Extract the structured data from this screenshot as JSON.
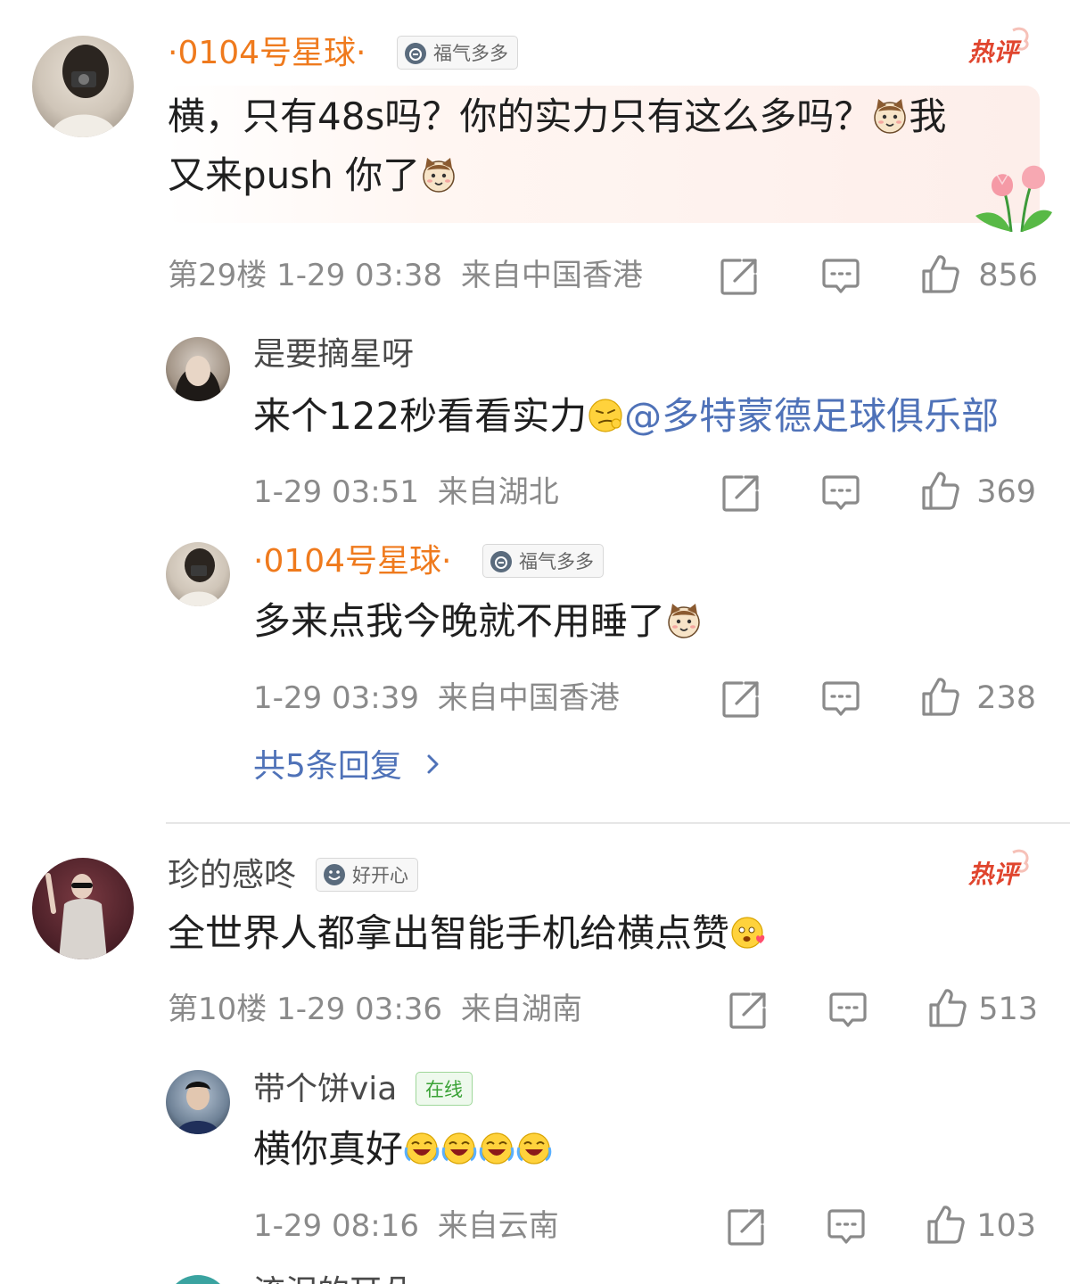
{
  "comments": [
    {
      "user": "·0104号星球·",
      "badge": "福气多多",
      "text": "横，只有48s吗？你的实力只有这么多吗？",
      "text2": "我",
      "text3": "又来push 你了",
      "floor": "第29楼",
      "time": "1-29 03:38",
      "location": "来自中国香港",
      "likes": "856",
      "hot_label": "热评",
      "replies": [
        {
          "user": "是要摘星呀",
          "text": "来个122秒看看实力",
          "mention": "@多特蒙德足球俱乐部",
          "time": "1-29 03:51",
          "location": "来自湖北",
          "likes": "369"
        },
        {
          "user": "·0104号星球·",
          "badge": "福气多多",
          "text": "多来点我今晚就不用睡了",
          "time": "1-29 03:39",
          "location": "来自中国香港",
          "likes": "238"
        }
      ],
      "more_replies": "共5条回复"
    },
    {
      "user": "珍的感咚",
      "badge": "好开心",
      "text": "全世界人都拿出智能手机给横点赞",
      "floor": "第10楼",
      "time": "1-29 03:36",
      "location": "来自湖南",
      "likes": "513",
      "hot_label": "热评",
      "replies": [
        {
          "user": "带个饼via",
          "badge": "在线",
          "text": "横你真好",
          "time": "1-29 08:16",
          "location": "来自云南",
          "likes": "103"
        }
      ]
    }
  ],
  "next_user_partial": "流泪的耳朵",
  "colors": {
    "orange_name": "#ef7a1d",
    "link_blue": "#4f72b8",
    "meta_gray": "#8a8a8a",
    "hot_red": "#e0452e"
  },
  "icons": {
    "share": "share-icon",
    "comment": "comment-icon",
    "like": "thumbs-up-icon"
  }
}
